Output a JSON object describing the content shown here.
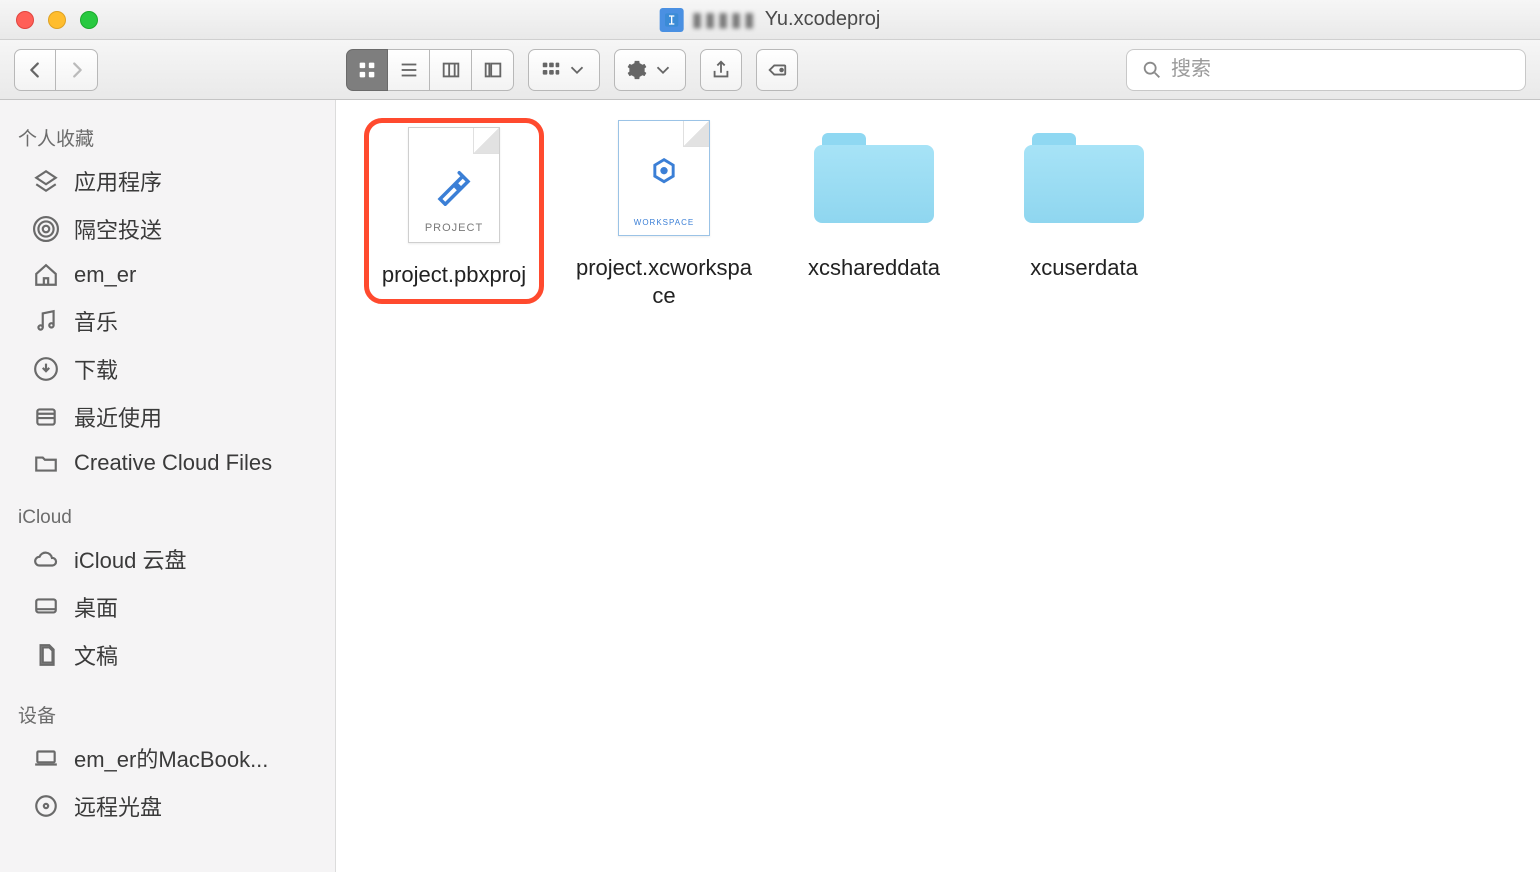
{
  "window": {
    "title_obscured": "▮▮▮▮▮",
    "title_suffix": "Yu.xcodeproj"
  },
  "toolbar": {
    "search_placeholder": "搜索"
  },
  "sidebar": {
    "sections": [
      {
        "title": "个人收藏",
        "items": [
          {
            "label": "应用程序"
          },
          {
            "label": "隔空投送"
          },
          {
            "label": "em_er"
          },
          {
            "label": "音乐"
          },
          {
            "label": "下载"
          },
          {
            "label": "最近使用"
          },
          {
            "label": "Creative Cloud Files"
          }
        ]
      },
      {
        "title": "iCloud",
        "items": [
          {
            "label": "iCloud 云盘"
          },
          {
            "label": "桌面"
          },
          {
            "label": "文稿"
          }
        ]
      },
      {
        "title": "设备",
        "items": [
          {
            "label": "em_er的MacBook..."
          },
          {
            "label": "远程光盘"
          }
        ]
      }
    ]
  },
  "content": {
    "items": [
      {
        "name": "project.pbxproj",
        "type": "project-file",
        "caption": "PROJECT",
        "highlighted": true
      },
      {
        "name": "project.xcworkspace",
        "type": "workspace-file",
        "caption": "WORKSPACE",
        "highlighted": false
      },
      {
        "name": "xcshareddata",
        "type": "folder",
        "highlighted": false
      },
      {
        "name": "xcuserdata",
        "type": "folder",
        "highlighted": false
      }
    ]
  }
}
